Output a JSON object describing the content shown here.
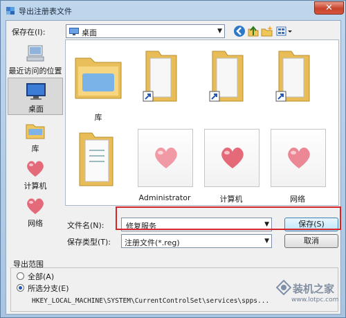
{
  "window": {
    "title": "导出注册表文件",
    "close_glyph": "✕"
  },
  "toolbar": {
    "save_in_label": "保存在(I):",
    "location": "桌面",
    "back_icon": "back-icon",
    "up_icon": "up-folder-icon",
    "newfolder_icon": "new-folder-icon",
    "views_icon": "views-menu-icon"
  },
  "places": [
    {
      "label": "最近访问的位置",
      "icon": "recent-places-icon"
    },
    {
      "label": "桌面",
      "icon": "desktop-icon",
      "selected": true
    },
    {
      "label": "库",
      "icon": "libraries-icon"
    },
    {
      "label": "计算机",
      "icon": "heart-icon"
    },
    {
      "label": "网络",
      "icon": "heart-icon"
    }
  ],
  "files": [
    {
      "label": "库",
      "icon": "library-folder-icon"
    },
    {
      "label": "",
      "icon": "shortcut-folder-icon"
    },
    {
      "label": "",
      "icon": "shortcut-folder-icon"
    },
    {
      "label": "",
      "icon": "shortcut-folder-icon"
    },
    {
      "label": "",
      "icon": "document-folder-icon"
    },
    {
      "label": "Administrator",
      "icon": "heart-icon"
    },
    {
      "label": "计算机",
      "icon": "heart-icon"
    },
    {
      "label": "网络",
      "icon": "heart-icon"
    }
  ],
  "form": {
    "filename_label": "文件名(N):",
    "filename_value": "修复服务",
    "filetype_label": "保存类型(T):",
    "filetype_value": "注册文件(*.reg)",
    "save_button": "保存(S)",
    "cancel_button": "取消"
  },
  "export_range": {
    "title": "导出范围",
    "all_label": "全部(A)",
    "branch_label": "所选分支(E)",
    "selected": "branch",
    "branch_path": "HKEY_LOCAL_MACHINE\\SYSTEM\\CurrentControlSet\\services\\spps..."
  },
  "watermark": {
    "text": "装机之家",
    "url": "www.lotpc.com"
  },
  "colors": {
    "highlight_box": "#d4242c",
    "heart": "#e46a7a"
  }
}
